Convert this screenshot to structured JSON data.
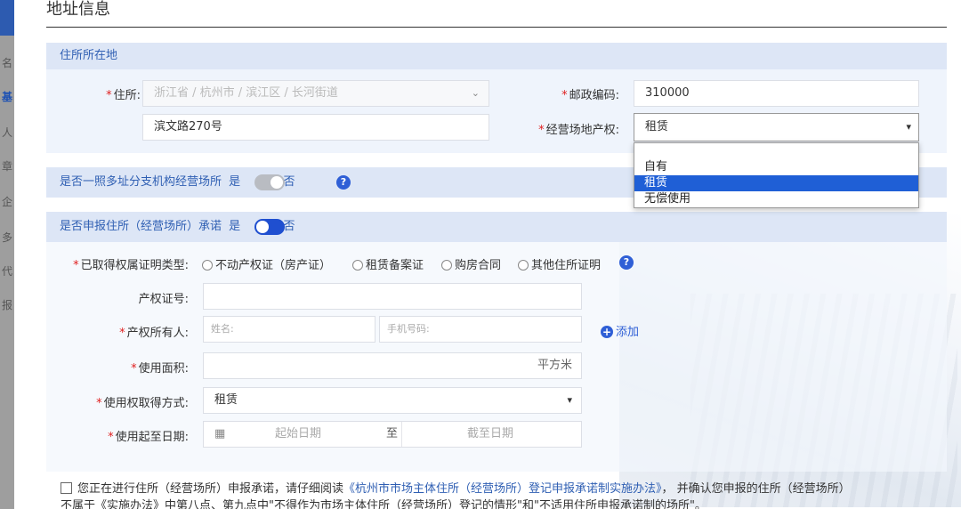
{
  "page_title": "地址信息",
  "sidebar_chars": [
    "名",
    "基",
    "人",
    "章",
    "企",
    "多",
    "代",
    "报"
  ],
  "residence": {
    "header": "住所所在地",
    "address_label": "住所:",
    "address_region": "浙江省 / 杭州市 / 滨江区 / 长河街道",
    "address_detail": "滨文路270号",
    "postal_label": "邮政编码:",
    "postal_value": "310000",
    "property_label": "经营场地产权:",
    "property_value": "租赁",
    "property_options": [
      "",
      "自有",
      "租赁",
      "无偿使用"
    ]
  },
  "branch": {
    "question": "是否一照多址分支机构经营场所",
    "yes": "是",
    "no": "否"
  },
  "commitment": {
    "question": "是否申报住所（经营场所）承诺",
    "yes": "是",
    "no": "否",
    "cert_type_label": "已取得权属证明类型:",
    "cert_types": [
      "不动产权证（房产证）",
      "租赁备案证",
      "购房合同",
      "其他住所证明"
    ],
    "cert_no_label": "产权证号:",
    "owner_label": "产权所有人:",
    "owner_name_ph": "姓名:",
    "owner_phone_ph": "手机号码:",
    "add_label": "添加",
    "area_label": "使用面积:",
    "area_unit": "平方米",
    "acquire_label": "使用权取得方式:",
    "acquire_value": "租赁",
    "date_label": "使用起至日期:",
    "start_ph": "起始日期",
    "date_sep": "至",
    "end_ph": "截至日期"
  },
  "footer": {
    "text1": "您正在进行住所（经营场所）申报承诺，请仔细阅读",
    "link": "《杭州市市场主体住所（经营场所）登记申报承诺制实施办法》",
    "text2": "， 并确认您申报的住所（经营场所）",
    "text3": "不属于《实施办法》中第八点、第九点中\"不得作为市场主体住所（经营场所）登记的情形\"和\"不适用住所申报承诺制的场所\"。"
  },
  "colors": {
    "accent": "#2f5fd6",
    "header_text": "#2f5fb3",
    "required": "#e02020"
  }
}
